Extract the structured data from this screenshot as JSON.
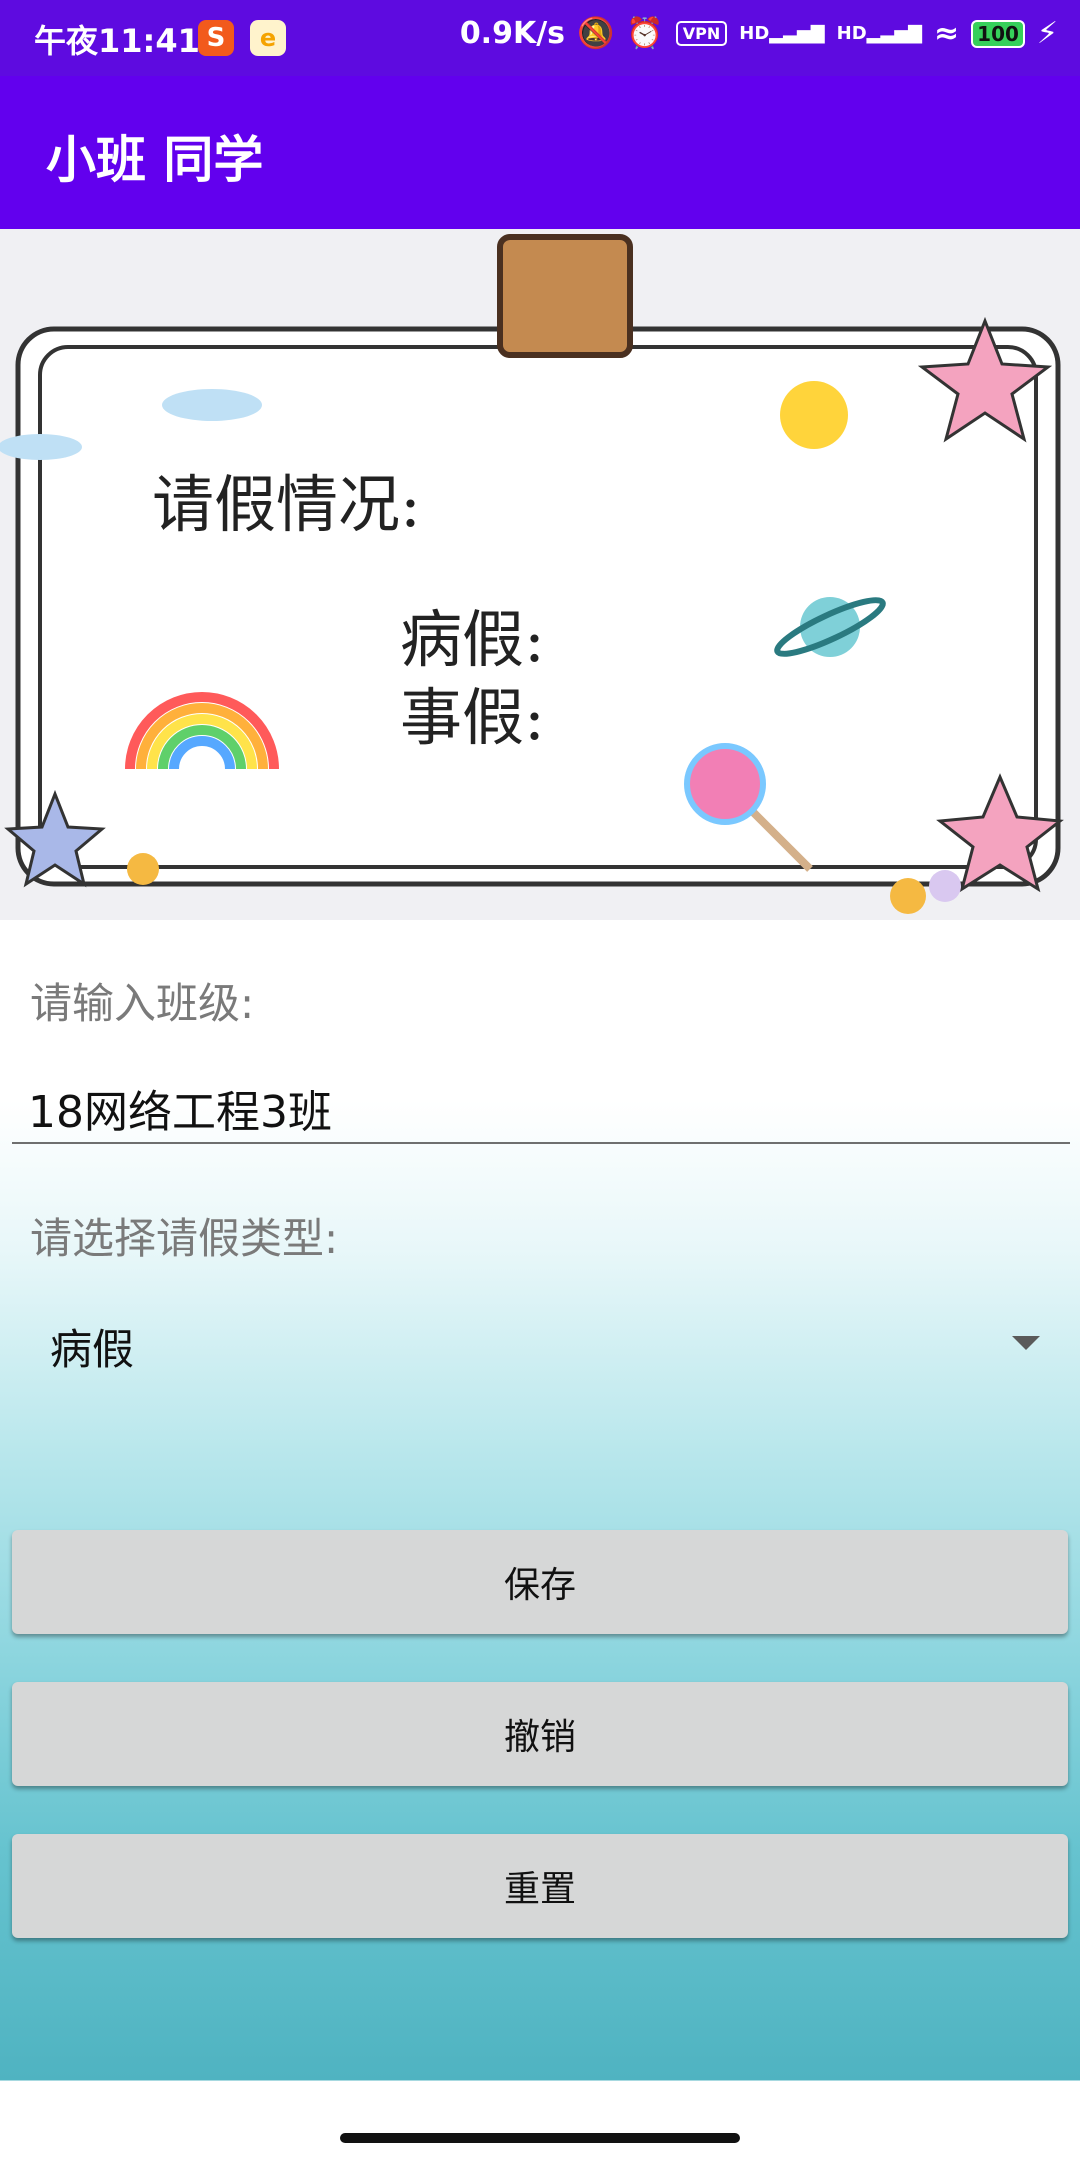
{
  "status_bar": {
    "time": "午夜11:41",
    "network_speed": "0.9K/s",
    "vpn_label": "VPN",
    "signal1_label": "HD",
    "signal2_label": "HD",
    "battery": "100",
    "app1_icon": "sogou-input-icon",
    "app2_icon": "notification-app-icon"
  },
  "app_bar": {
    "title": "小班 同学"
  },
  "banner": {
    "heading": "请假情况:",
    "line1": "病假:",
    "line2": "事假:"
  },
  "form": {
    "class_label": "请输入班级:",
    "class_value": "18网络工程3班",
    "type_label": "请选择请假类型:",
    "type_selected": "病假"
  },
  "buttons": {
    "save": "保存",
    "undo": "撤销",
    "reset": "重置"
  },
  "colors": {
    "status_bar": "#5e0be0",
    "app_bar": "#6200ee",
    "button_bg": "#d6d7d7"
  }
}
